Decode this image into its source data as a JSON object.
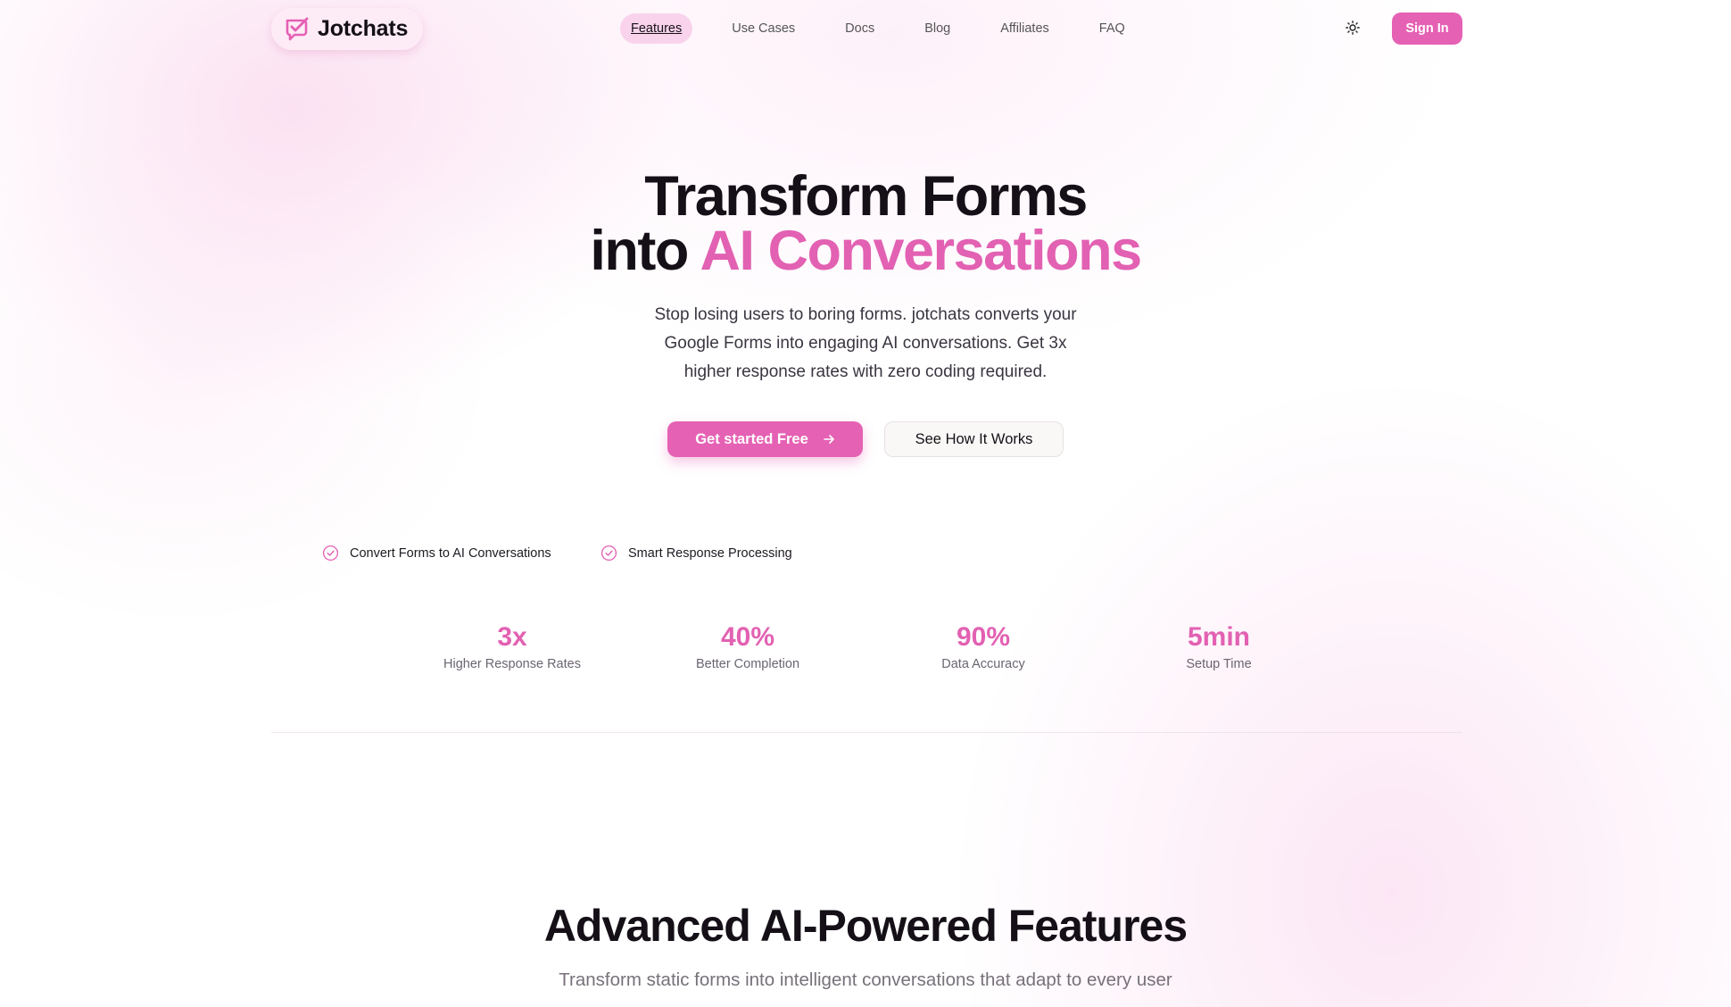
{
  "brand": {
    "name": "Jotchats",
    "accent": "#e561b4"
  },
  "nav": {
    "items": [
      "Features",
      "Use Cases",
      "Docs",
      "Blog",
      "Affiliates",
      "FAQ"
    ],
    "active": "Features",
    "theme_icon": "sun-icon",
    "signin_label": "Sign In"
  },
  "hero": {
    "title_line1": "Transform Forms",
    "title_line2_prefix": "into",
    "title_line2_accent": "AI Conversations",
    "subtitle": "Stop losing users to boring forms. jotchats converts your Google Forms into engaging AI conversations. Get 3x higher response rates with zero coding required.",
    "primary_cta": "Get started Free",
    "secondary_cta": "See How It Works"
  },
  "features": [
    "Convert Forms to AI Conversations",
    "Smart Response Processing"
  ],
  "stats": [
    {
      "value": "3x",
      "label": "Higher Response Rates"
    },
    {
      "value": "40%",
      "label": "Better Completion"
    },
    {
      "value": "90%",
      "label": "Data Accuracy"
    },
    {
      "value": "5min",
      "label": "Setup Time"
    }
  ],
  "section": {
    "title": "Advanced AI-Powered Features",
    "subtitle": "Transform static forms into intelligent conversations that adapt to every user"
  }
}
